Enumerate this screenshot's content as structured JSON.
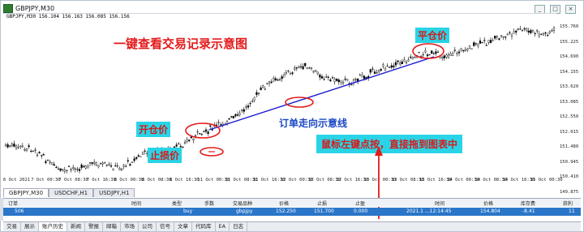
{
  "window": {
    "title": "GBPJPY,M30",
    "controls": [
      "_",
      "□",
      "×"
    ]
  },
  "chart": {
    "quote_line": "GBPJPY,M30 156.104 156.163 156.085 156.156",
    "price_axis": [
      "155.760",
      "155.225",
      "154.690",
      "154.155",
      "153.620",
      "153.085",
      "152.550",
      "152.015",
      "151.480",
      "150.945",
      "150.410",
      "149.875"
    ],
    "time_axis": [
      "6 Oct 2021",
      "7 Oct 00:30",
      "7 Oct 08:30",
      "7 Oct 16:30",
      "8 Oct 00:30",
      "8 Oct 08:30",
      "8 Oct 16:30",
      "11 Oct 00:30",
      "11 Oct 08:30",
      "11 Oct 16:30",
      "12 Oct 00:30",
      "12 Oct 08:30",
      "12 Oct 16:30",
      "13 Oct 00:30",
      "13 Oct 08:30",
      "13 Oct 16:30",
      "14 Oct 00:30",
      "14 Oct 08:30",
      "14 Oct 16:30",
      "15 Oct 00:30"
    ],
    "tabs": [
      "GBPJPY,M30",
      "USDCHF,H1",
      "USDJPY,H1"
    ],
    "active_tab": 0,
    "colors": {
      "candle": "#000000",
      "trade_line": "#1a1ad0",
      "circle": "#e21b1b",
      "highlight": "#29d4e6"
    }
  },
  "annotations": {
    "title": "一键查看交易记录示意图",
    "close_price_top": "平仓价",
    "open_price": "开仓价",
    "stop_loss": "止损价",
    "order_direction": "订单走向示意线",
    "instruction": "鼠标左键点按，直接拖到图表中"
  },
  "terminal": {
    "columns": [
      "订单",
      "时间",
      "类型",
      "手数",
      "交易品种",
      "价格",
      "止损",
      "止盈",
      "时间",
      "价格",
      "库存费",
      "获利"
    ],
    "row": {
      "order": "506",
      "open_time": "",
      "type": "buy",
      "lots": "",
      "symbol": "gbpjpy",
      "price": "152.250",
      "sl": "151.700",
      "tp": "0.000",
      "close_time": "2021.1 ...12:14:45",
      "close_price": "154.804",
      "swap": "-8.41",
      "profit": "11"
    }
  },
  "bottom_tabs": [
    "交易",
    "展示",
    "账户历史",
    "新闻",
    "警报",
    "邮箱",
    "市场",
    "公司",
    "信号",
    "文章",
    "代码库",
    "EA",
    "日志"
  ],
  "bottom_tabs_active": 2
}
